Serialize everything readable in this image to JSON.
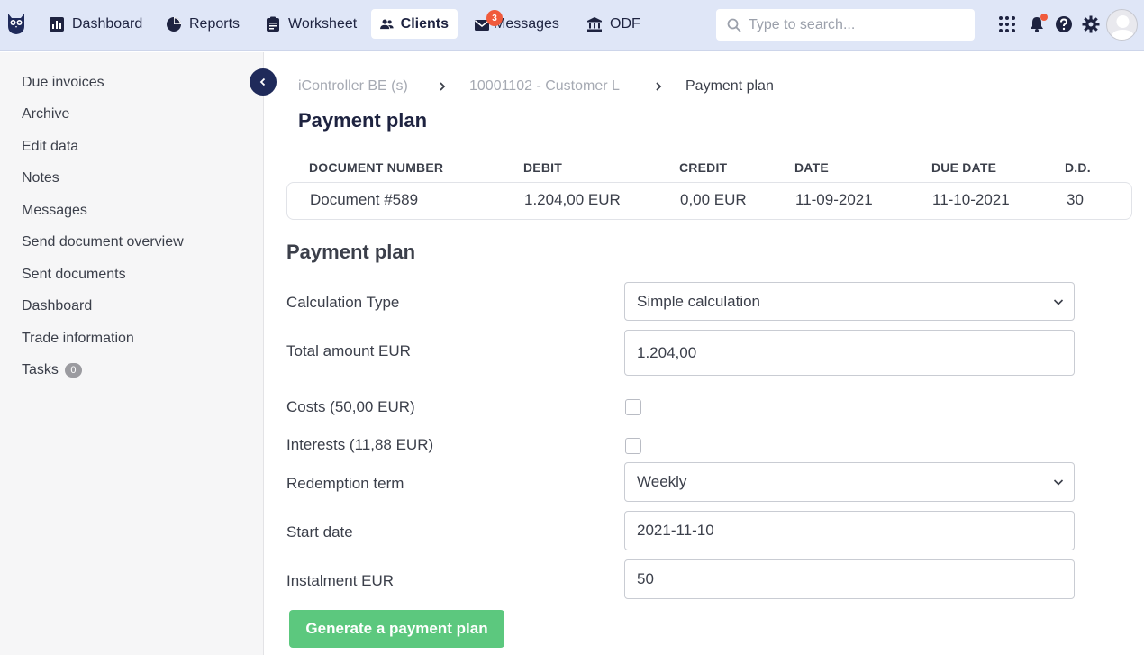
{
  "nav": {
    "items": [
      {
        "label": "Dashboard",
        "icon": "bar-chart-icon"
      },
      {
        "label": "Reports",
        "icon": "pie-chart-icon"
      },
      {
        "label": "Worksheet",
        "icon": "clipboard-icon"
      },
      {
        "label": "Clients",
        "icon": "users-icon",
        "active": true
      },
      {
        "label": "Messages",
        "icon": "envelope-icon",
        "badge": "3"
      },
      {
        "label": "ODF",
        "icon": "bank-icon"
      }
    ],
    "search_placeholder": "Type to search..."
  },
  "sidebar": {
    "items": [
      {
        "label": "Due invoices"
      },
      {
        "label": "Archive"
      },
      {
        "label": "Edit data"
      },
      {
        "label": "Notes"
      },
      {
        "label": "Messages"
      },
      {
        "label": "Send document overview"
      },
      {
        "label": "Sent documents"
      },
      {
        "label": "Dashboard"
      },
      {
        "label": "Trade information"
      },
      {
        "label": "Tasks",
        "count": "0"
      }
    ]
  },
  "breadcrumb": {
    "items": [
      "iController BE (s)",
      "10001102 - Customer L",
      "Payment plan"
    ]
  },
  "page": {
    "title": "Payment plan"
  },
  "table": {
    "headers": [
      "DOCUMENT NUMBER",
      "DEBIT",
      "CREDIT",
      "DATE",
      "DUE DATE",
      "D.D."
    ],
    "row": [
      "Document #589",
      "1.204,00 EUR",
      "0,00 EUR",
      "11-09-2021",
      "11-10-2021",
      "30"
    ]
  },
  "form": {
    "title": "Payment plan",
    "calculation_type": {
      "label": "Calculation Type",
      "value": "Simple calculation"
    },
    "total_amount": {
      "label": "Total amount EUR",
      "value": "1.204,00"
    },
    "costs": {
      "label": "Costs (50,00 EUR)",
      "checked": false
    },
    "interests": {
      "label": "Interests (11,88 EUR)",
      "checked": false
    },
    "redemption_term": {
      "label": "Redemption term",
      "value": "Weekly"
    },
    "start_date": {
      "label": "Start date",
      "value": "2021-11-10"
    },
    "instalment": {
      "label": "Instalment EUR",
      "value": "50"
    },
    "generate_button": "Generate a payment plan"
  },
  "colors": {
    "topbar": "#dfe6f7",
    "navy": "#1e2340",
    "accent_green": "#5cc87e",
    "badge_red": "#f05a3c"
  }
}
